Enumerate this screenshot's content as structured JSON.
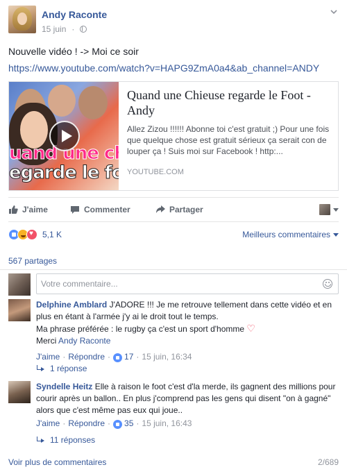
{
  "post": {
    "author": "Andy Raconte",
    "date": "15 juin",
    "text": "Nouvelle vidéo ! -> Moi ce soir",
    "url": "https://www.youtube.com/watch?v=HAPG9ZmA0a4&ab_channel=ANDY"
  },
  "preview": {
    "thumb_caption_line1": "uand une chieus",
    "thumb_caption_line2": "egarde le foot",
    "title": "Quand une Chieuse regarde le Foot - Andy",
    "description": "Allez Zizou !!!!!! Abonne toi c'est gratuit ;) Pour une fois que quelque chose est gratuit sérieux ça serait con de louper ça ! Suis moi sur Facebook ! http:...",
    "source": "YOUTUBE.COM"
  },
  "actions": {
    "like": "J'aime",
    "comment": "Commenter",
    "share": "Partager"
  },
  "reactions": {
    "count": "5,1 K",
    "sort_label": "Meilleurs commentaires",
    "icons": [
      "like-icon",
      "haha-icon",
      "love-icon"
    ]
  },
  "shares": "567 partages",
  "comment_box": {
    "placeholder": "Votre commentaire..."
  },
  "comments": [
    {
      "name": "Delphine Amblard",
      "lines": [
        "J'ADORE !!! Je me retrouve tellement dans cette vidéo et en plus en étant à l'armée j'y ai le droit tout le temps.",
        "Ma phrase préférée : le rugby ça c'est un sport d'homme"
      ],
      "mention_prefix": "Merci",
      "mention": "Andy Raconte",
      "like_label": "J'aime",
      "reply_label": "Répondre",
      "likes": "17",
      "time": "15 juin, 16:34",
      "replies": "1 réponse"
    },
    {
      "name": "Syndelle Heitz",
      "text": "Elle à raison le foot c'est d'la merde, ils gagnent des millions pour courir après un ballon.. En plus j'comprend pas les gens qui disent \"on à gagné\" alors que c'est même pas eux qui joue..",
      "like_label": "J'aime",
      "reply_label": "Répondre",
      "likes": "35",
      "time": "15 juin, 16:43",
      "replies": "11 réponses"
    }
  ],
  "footer": {
    "more_comments": "Voir plus de commentaires",
    "pager": "2/689"
  },
  "colors": {
    "link": "#365899",
    "meta_grey": "#90949c",
    "like_blue": "#5890ff",
    "love_red": "#f25268",
    "haha_yellow": "#f7b125"
  }
}
